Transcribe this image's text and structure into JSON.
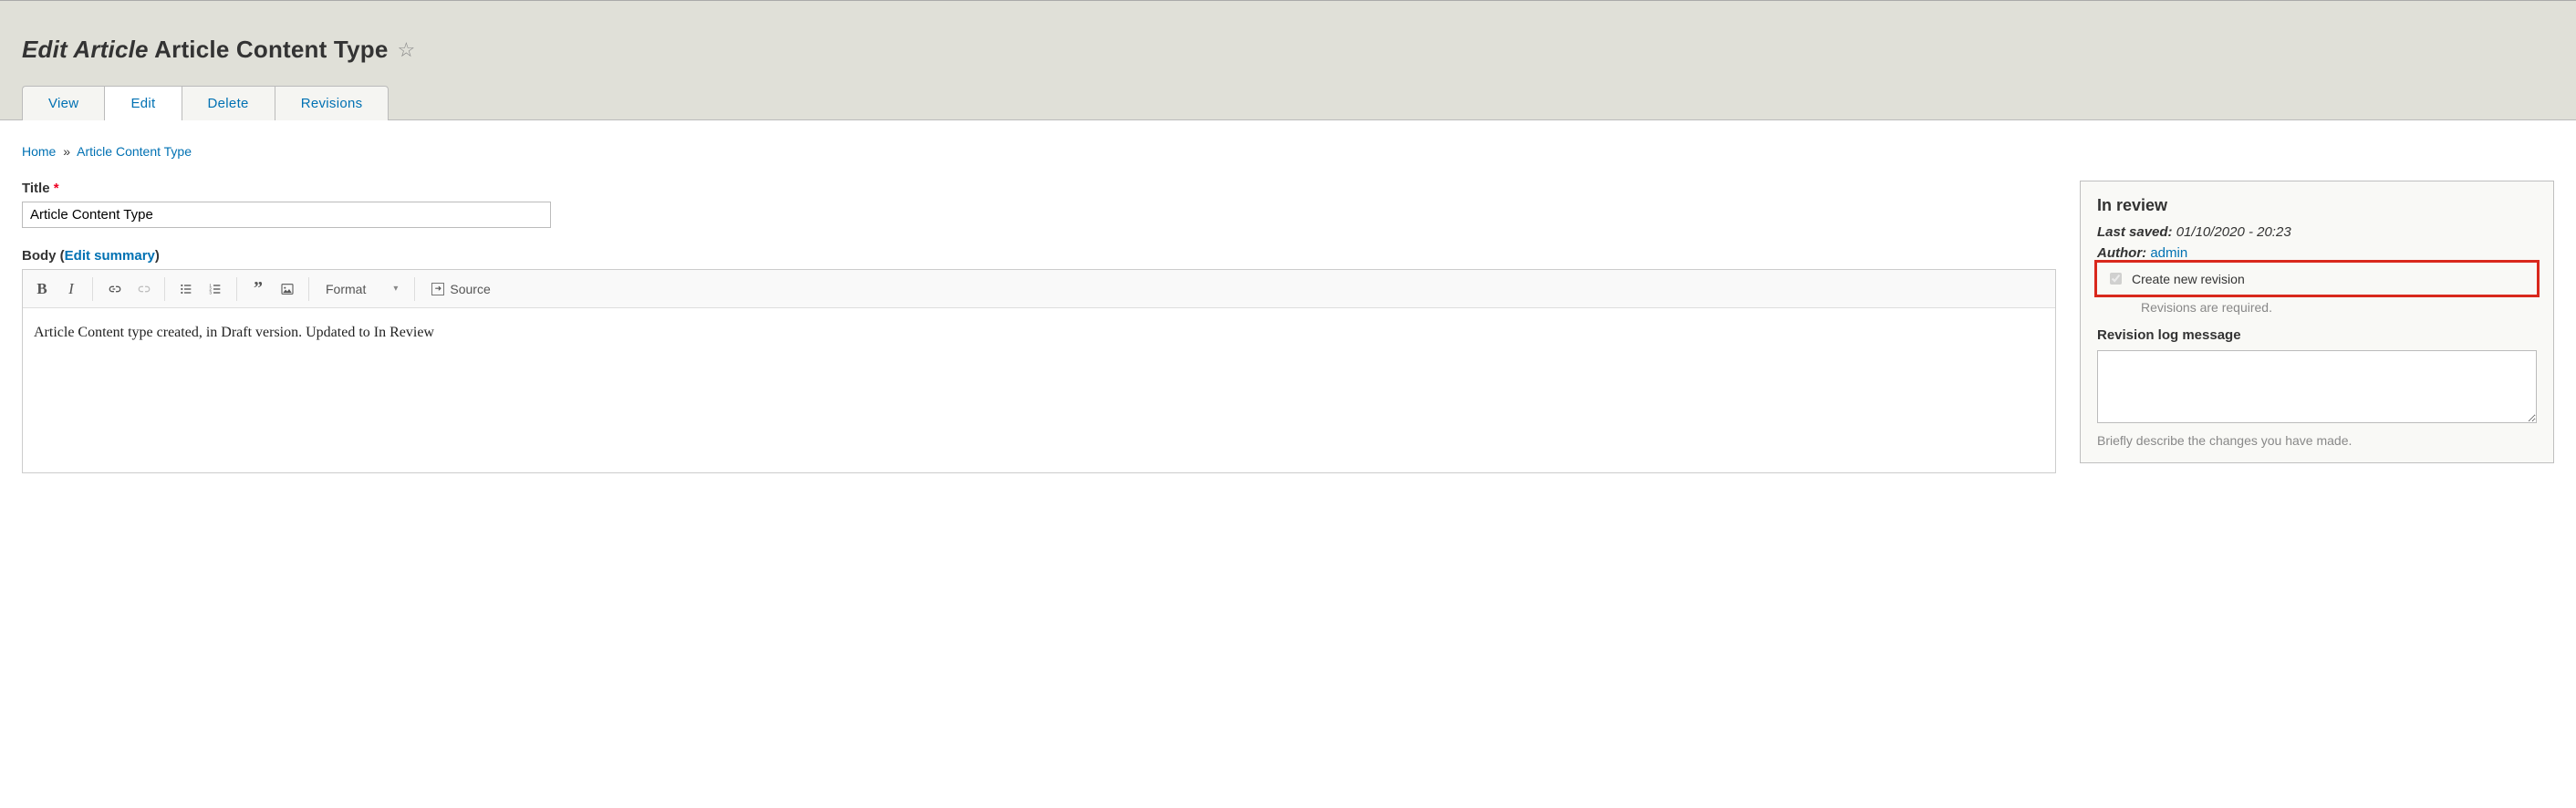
{
  "page_title_prefix": "Edit Article",
  "page_title_main": "Article Content Type",
  "tabs": {
    "view": "View",
    "edit": "Edit",
    "delete": "Delete",
    "revisions": "Revisions"
  },
  "breadcrumb": {
    "home": "Home",
    "sep": "»",
    "current": "Article Content Type"
  },
  "fields": {
    "title_label": "Title",
    "title_value": "Article Content Type",
    "body_label": "Body",
    "edit_summary": "Edit summary"
  },
  "editor": {
    "format_label": "Format",
    "source_label": "Source",
    "content": "Article Content type created, in Draft version. Updated to In Review"
  },
  "sidebar": {
    "status": "In review",
    "last_saved_label": "Last saved:",
    "last_saved_value": "01/10/2020 - 20:23",
    "author_label": "Author:",
    "author_value": "admin",
    "create_revision_label": "Create new revision",
    "revisions_required": "Revisions are required.",
    "rev_log_label": "Revision log message",
    "rev_log_value": "",
    "rev_log_help": "Briefly describe the changes you have made."
  }
}
